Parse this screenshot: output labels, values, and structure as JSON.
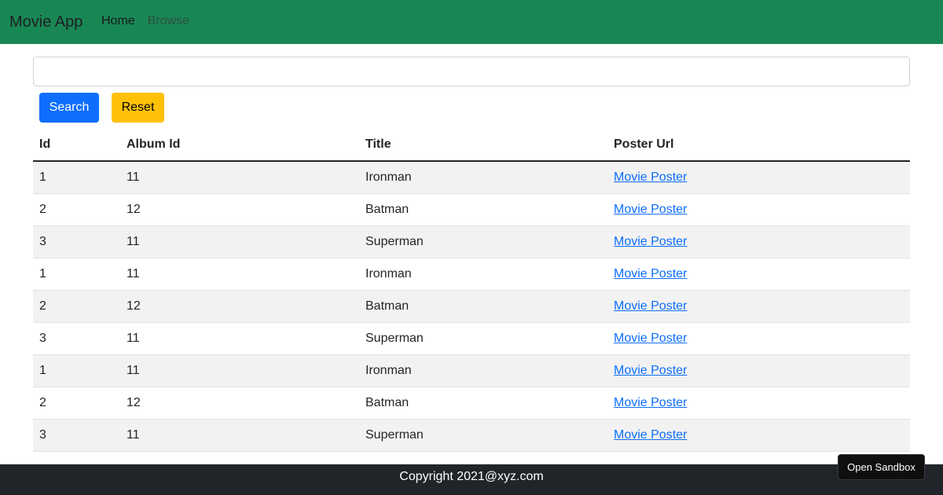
{
  "navbar": {
    "brand": "Movie App",
    "links": [
      "Home",
      "Browse"
    ],
    "color": "#198754"
  },
  "search": {
    "value": "",
    "placeholder": "",
    "search_label": "Search",
    "reset_label": "Reset"
  },
  "table": {
    "headers": [
      "Id",
      "Album Id",
      "Title",
      "Poster Url"
    ],
    "rows": [
      [
        "1",
        "11",
        "Ironman",
        "Movie Poster"
      ],
      [
        "2",
        "12",
        "Batman",
        "Movie Poster"
      ],
      [
        "3",
        "11",
        "Superman",
        "Movie Poster"
      ],
      [
        "1",
        "11",
        "Ironman",
        "Movie Poster"
      ],
      [
        "2",
        "12",
        "Batman",
        "Movie Poster"
      ],
      [
        "3",
        "11",
        "Superman",
        "Movie Poster"
      ],
      [
        "1",
        "11",
        "Ironman",
        "Movie Poster"
      ],
      [
        "2",
        "12",
        "Batman",
        "Movie Poster"
      ],
      [
        "3",
        "11",
        "Superman",
        "Movie Poster"
      ]
    ]
  },
  "footer": {
    "copyright": "Copyright 2021@xyz.com"
  },
  "sandbox": {
    "label": "Open Sandbox"
  }
}
